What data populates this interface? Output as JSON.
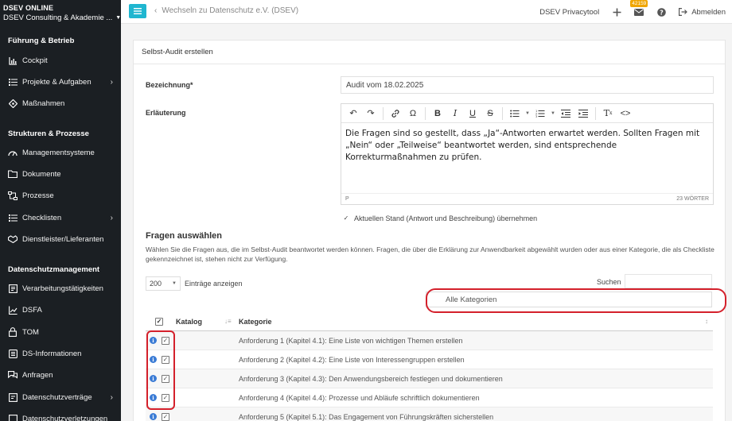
{
  "brand": {
    "title": "DSEV ONLINE",
    "org": "DSEV Consulting & Akademie ..."
  },
  "sidebar": {
    "sections": [
      {
        "title": "Führung & Betrieb"
      },
      {
        "title": "Strukturen & Prozesse"
      },
      {
        "title": "Datenschutzmanagement"
      }
    ],
    "items": [
      {
        "label": "Cockpit"
      },
      {
        "label": "Projekte & Aufgaben"
      },
      {
        "label": "Maßnahmen"
      },
      {
        "label": "Managementsysteme"
      },
      {
        "label": "Dokumente"
      },
      {
        "label": "Prozesse"
      },
      {
        "label": "Checklisten"
      },
      {
        "label": "Dienstleister/Lieferanten"
      },
      {
        "label": "Verarbeitungstätigkeiten"
      },
      {
        "label": "DSFA"
      },
      {
        "label": "TOM"
      },
      {
        "label": "DS-Informationen"
      },
      {
        "label": "Anfragen"
      },
      {
        "label": "Datenschutzverträge"
      },
      {
        "label": "Datenschutzverletzungen"
      }
    ]
  },
  "topbar": {
    "back_label": "Wechseln zu Datenschutz e.V. (DSEV)",
    "privacy_label": "DSEV Privacytool",
    "badge_count": "42159",
    "logout_label": "Abmelden"
  },
  "card": {
    "title": "Selbst-Audit erstellen",
    "bezeichnung_label": "Bezeichnung*",
    "bezeichnung_value": "Audit vom 18.02.2025",
    "erlaeuterung_label": "Erläuterung",
    "editor_text": "Die Fragen sind so gestellt, dass „Ja“-Antworten erwartet werden. Sollten Fragen mit „Nein“ oder „Teilweise“ beantwortet werden, sind entsprechende Korrekturmaßnahmen zu prüfen.",
    "editor_path": "P",
    "editor_wordcount": "23 WÖRTER",
    "current_state_label": "Aktuellen Stand (Antwort und Beschreibung) übernehmen"
  },
  "fragen": {
    "title": "Fragen auswählen",
    "description": "Wählen Sie die Fragen aus, die im Selbst-Audit beantwortet werden können. Fragen, die über die Erklärung zur Anwendbarkeit abgewählt wurden oder aus einer Kategorie, die als Checkliste gekennzeichnet ist, stehen nicht zur Verfügung.",
    "page_size": "200",
    "entries_label": "Einträge anzeigen",
    "search_label": "Suchen",
    "category_filter": "Alle Kategorien",
    "columns": {
      "katalog": "Katalog",
      "kategorie": "Kategorie"
    },
    "rows": [
      {
        "text": "Anforderung 1 (Kapitel 4.1): Eine Liste von wichtigen Themen erstellen"
      },
      {
        "text": "Anforderung 2 (Kapitel 4.2): Eine Liste von Interessengruppen erstellen"
      },
      {
        "text": "Anforderung 3 (Kapitel 4.3): Den Anwendungsbereich festlegen und dokumentieren"
      },
      {
        "text": "Anforderung 4 (Kapitel 4.4): Prozesse und Abläufe schriftlich dokumentieren"
      },
      {
        "text": "Anforderung 5 (Kapitel 5.1): Das Engagement von Führungskräften sicherstellen"
      }
    ]
  },
  "colors": {
    "accent": "#1fb6d0",
    "sidebar_bg": "#1b1f23",
    "highlight": "#d4202b",
    "badge": "#f0a500",
    "info": "#3a7bd5"
  }
}
